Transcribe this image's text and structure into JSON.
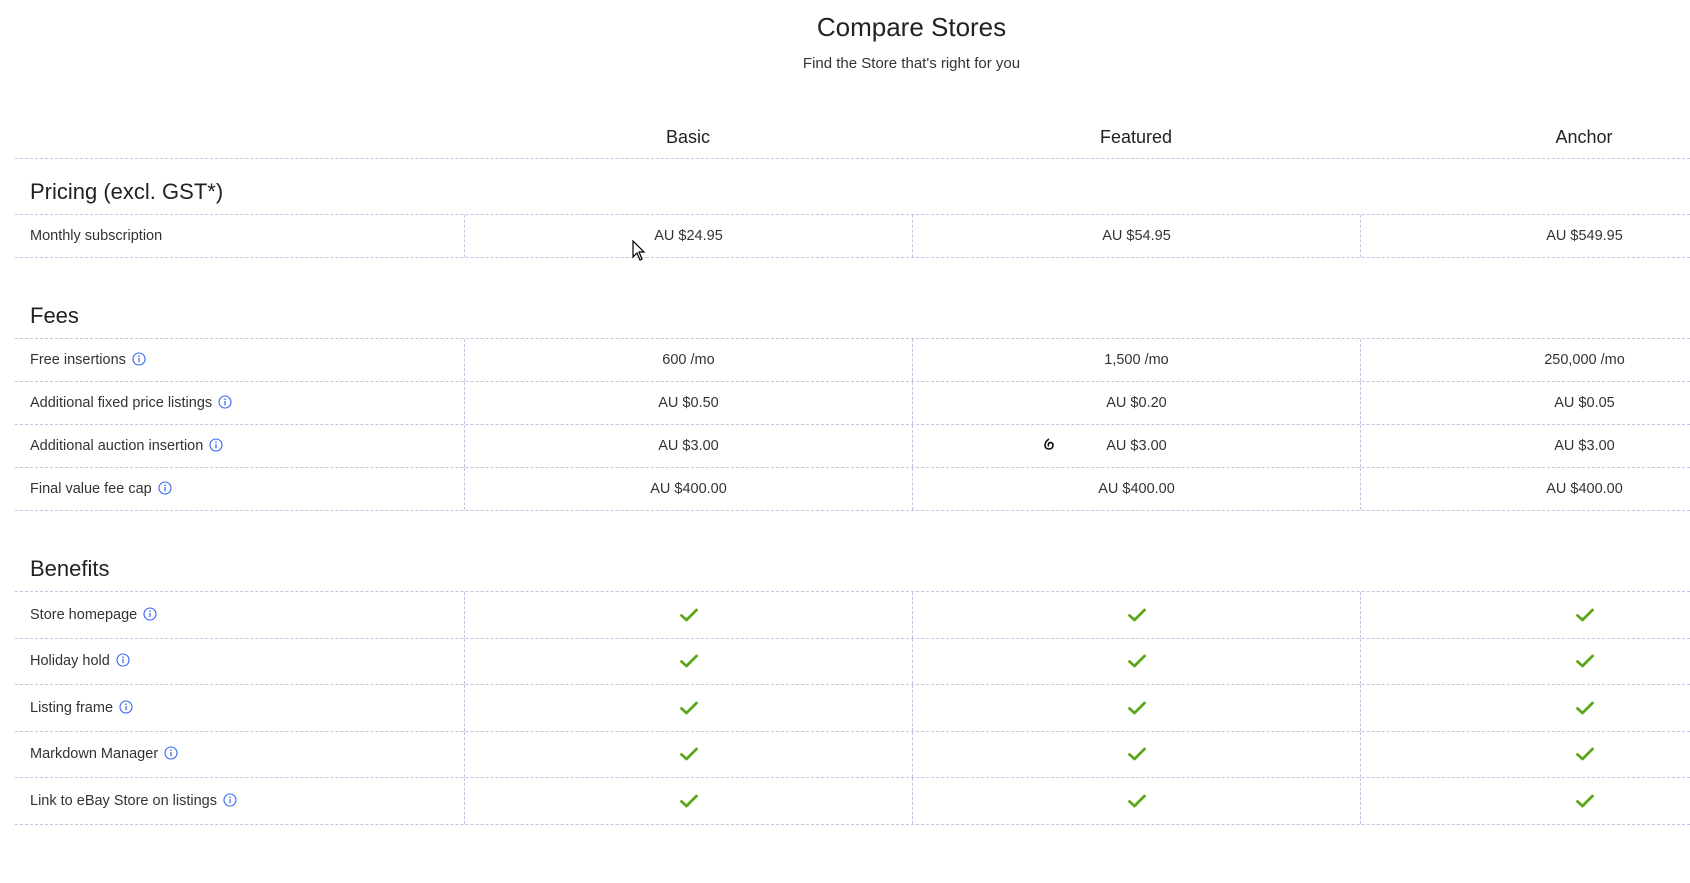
{
  "header": {
    "title": "Compare Stores",
    "subtitle": "Find the Store that's right for you"
  },
  "plans": [
    "Basic",
    "Featured",
    "Anchor"
  ],
  "sections": {
    "pricing": {
      "title": "Pricing (excl. GST*)",
      "rows": [
        {
          "label": "Monthly subscription",
          "values": [
            "AU $24.95",
            "AU $54.95",
            "AU $549.95"
          ],
          "info": false
        }
      ]
    },
    "fees": {
      "title": "Fees",
      "rows": [
        {
          "label": "Free insertions",
          "values": [
            "600 /mo",
            "1,500 /mo",
            "250,000 /mo"
          ],
          "info": true
        },
        {
          "label": "Additional fixed price listings",
          "values": [
            "AU $0.50",
            "AU $0.20",
            "AU $0.05"
          ],
          "info": true
        },
        {
          "label": "Additional auction insertion",
          "values": [
            "AU $3.00",
            "AU $3.00",
            "AU $3.00"
          ],
          "info": true
        },
        {
          "label": "Final value fee cap",
          "values": [
            "AU $400.00",
            "AU $400.00",
            "AU $400.00"
          ],
          "info": true
        }
      ]
    },
    "benefits": {
      "title": "Benefits",
      "rows": [
        {
          "label": "Store homepage",
          "values": [
            true,
            true,
            true
          ],
          "info": true
        },
        {
          "label": "Holiday hold",
          "values": [
            true,
            true,
            true
          ],
          "info": true
        },
        {
          "label": "Listing frame",
          "values": [
            true,
            true,
            true
          ],
          "info": true
        },
        {
          "label": "Markdown Manager",
          "values": [
            true,
            true,
            true
          ],
          "info": true
        },
        {
          "label": "Link to eBay Store on listings",
          "values": [
            true,
            true,
            true
          ],
          "info": true
        }
      ]
    }
  },
  "icons": {
    "info": "info-circle-icon",
    "check": "checkmark-icon",
    "cursor": "mouse-pointer-icon"
  },
  "colors": {
    "check": "#5ba71b",
    "info": "#3665f3",
    "divider": "#c3c5e0"
  }
}
